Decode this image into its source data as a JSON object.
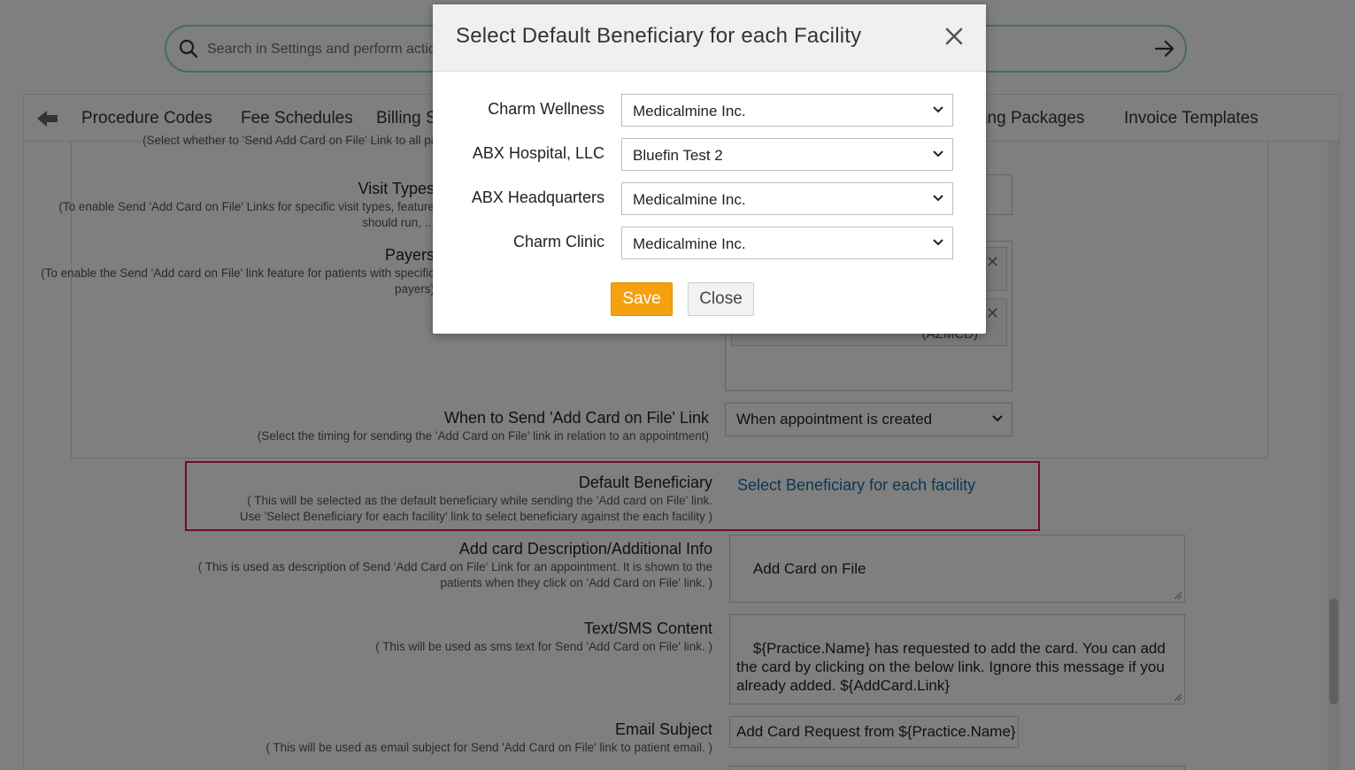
{
  "search": {
    "placeholder": "Search in Settings and perform actions"
  },
  "tabs": [
    {
      "label": "Procedure Codes"
    },
    {
      "label": "Fee Schedules"
    },
    {
      "label": "Billing Settings"
    },
    {
      "label": "Billing Packages"
    },
    {
      "label": "Invoice Templates"
    }
  ],
  "background": {
    "top_hint": "(Select whether to 'Send Add Card on File' Link to all patients)",
    "visit_types": {
      "label": "Visit Types",
      "hint": "(To enable Send 'Add Card on File' Links for specific visit types, feature should run, ..."
    },
    "payers": {
      "label": "Payers",
      "hint": "(To enable the Send 'Add card on File' link feature for patients with specific payers)",
      "tag_fragment": "(AZMCD)"
    },
    "when_to_send": {
      "label": "When to Send 'Add Card on File' Link",
      "hint": "(Select the timing for sending the 'Add Card on File' link in relation to an appointment)",
      "value": "When appointment is created"
    },
    "default_beneficiary": {
      "label": "Default Beneficiary",
      "hint_line1": "( This will be selected as the default beneficiary while sending the 'Add card on File' link.",
      "hint_line2": "Use 'Select Beneficiary for each facility' link to select beneficiary against the each facility )",
      "link": "Select Beneficiary for each facility"
    },
    "add_card_desc": {
      "label": "Add card Description/Additional Info",
      "hint_line1": "( This is used as description of Send 'Add Card on File' Link for an appointment. It is shown to the",
      "hint_line2": "patients when they click on 'Add Card on File' link. )",
      "value": "Add Card on File"
    },
    "sms_content": {
      "label": "Text/SMS Content",
      "hint": "( This will be used as sms text for Send 'Add Card on File' link. )",
      "value": "${Practice.Name} has requested to add the card. You can add the card by clicking on the below link. Ignore this message if you already added. ${AddCard.Link}"
    },
    "email_subject": {
      "label": "Email Subject",
      "hint": "( This will be used as email subject for Send 'Add Card on File' link to patient email. )",
      "value": "Add Card Request from ${Practice.Name}"
    }
  },
  "modal": {
    "title": "Select Default Beneficiary for each Facility",
    "rows": [
      {
        "facility": "Charm Wellness",
        "beneficiary": "Medicalmine Inc."
      },
      {
        "facility": "ABX Hospital, LLC",
        "beneficiary": "Bluefin Test 2"
      },
      {
        "facility": "ABX Headquarters",
        "beneficiary": "Medicalmine Inc."
      },
      {
        "facility": "Charm Clinic",
        "beneficiary": "Medicalmine Inc."
      }
    ],
    "save_label": "Save",
    "close_label": "Close"
  },
  "colors": {
    "accent": "#f5a10f",
    "link": "#1a6ea8",
    "highlight": "#e8175d",
    "search_border": "#8fd3cc"
  }
}
